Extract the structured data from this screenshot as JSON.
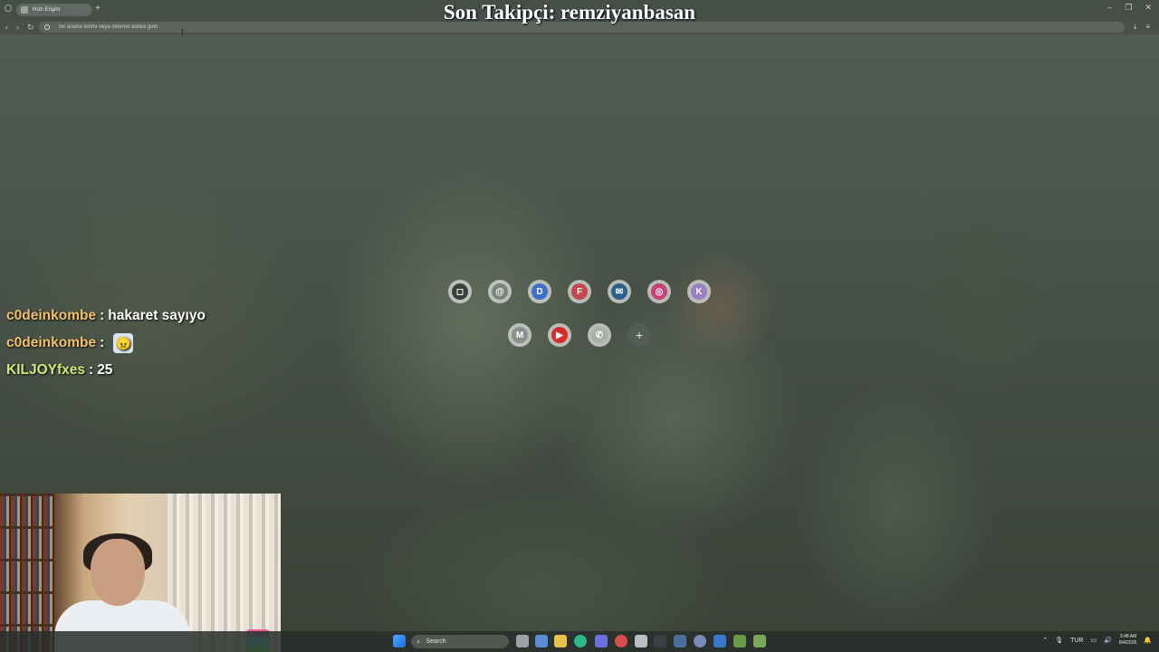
{
  "browser": {
    "tab_title": "Hızlı Erişim",
    "new_tab_icon": "+",
    "address_placeholder": "Bir arama terimi veya internet adresi girin",
    "window_controls": [
      "–",
      "❐",
      "✕"
    ]
  },
  "overlay": {
    "last_follower": "Son Takipçi: remziyanbasan"
  },
  "chat": [
    {
      "user": "c0deinkombe",
      "sep": ":",
      "message": "hakaret sayıyo",
      "emote": ""
    },
    {
      "user": "c0deinkombe",
      "sep": ":",
      "message": "",
      "emote": "emote-icon"
    },
    {
      "user": "KILJOYfxes",
      "sep": ":",
      "message": "25",
      "emote": ""
    }
  ],
  "shortcuts": {
    "row1": [
      {
        "icon": "square-icon",
        "letter": "◻",
        "color": "#3a3f3c"
      },
      {
        "icon": "threads-icon",
        "letter": "@",
        "color": "#7c847e"
      },
      {
        "icon": "letter-d-icon",
        "letter": "D",
        "color": "#3f6fc9"
      },
      {
        "icon": "letter-f-icon",
        "letter": "F",
        "color": "#c6464f"
      },
      {
        "icon": "mail-icon",
        "letter": "✉",
        "color": "#2d5f8a"
      },
      {
        "icon": "instagram-icon",
        "letter": "◎",
        "color": "#c9407a"
      },
      {
        "icon": "letter-k-icon",
        "letter": "K",
        "color": "#9a7fc4"
      }
    ],
    "row2": [
      {
        "icon": "letter-m-icon",
        "letter": "M",
        "color": "#8c8f8c"
      },
      {
        "icon": "youtube-icon",
        "letter": "▶",
        "color": "#d92b2b"
      },
      {
        "icon": "whatsapp-icon",
        "letter": "✆",
        "color": "#a9b0aa"
      }
    ],
    "add_label": "+"
  },
  "taskbar": {
    "search_label": "Search",
    "language": "TUR",
    "time": "3:48 AM",
    "date": "8/4/2026"
  }
}
